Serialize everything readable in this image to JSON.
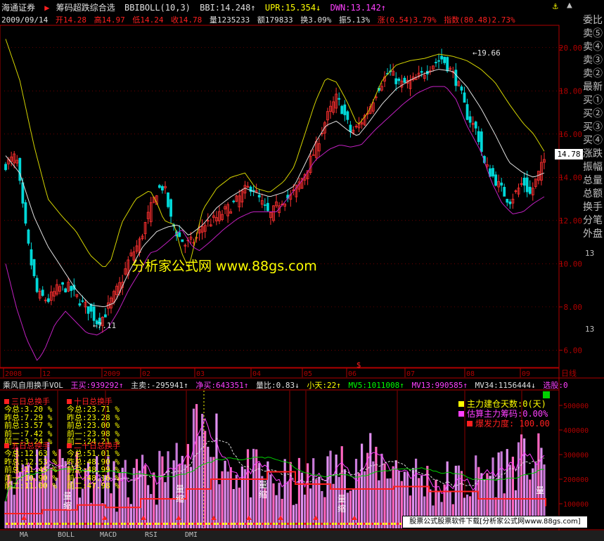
{
  "header": {
    "app_name": "海通证券",
    "indicator_name": "筹码超跌综合选",
    "bbiboll": "BBIBOLL(10,3)",
    "bbi": "BBI:14.248↑",
    "upr": "UPR:15.354↓",
    "dwn": "DWN:13.142↑",
    "date": "2009/09/14",
    "open": "开14.28",
    "high": "高14.97",
    "low": "低14.24",
    "close": "收14.78",
    "volume": "量1235233",
    "amount": "额179833",
    "turnover": "换3.09%",
    "amplitude": "振5.13%",
    "change": "涨(0.54)3.79%",
    "index": "指数(80.48)2.73%"
  },
  "colors": {
    "upper": "#d4d400",
    "mid": "#e0e0e0",
    "lower": "#c020c0",
    "up_candle": "#ff3030",
    "down_candle": "#00d8d8",
    "axis": "#b00000",
    "yellow": "#ffff00",
    "magenta": "#ff40ff",
    "white": "#e0e0e0",
    "green": "#00ff00",
    "red": "#ff2020"
  },
  "price_axis": {
    "ticks": [
      "20.00",
      "18.00",
      "16.00",
      "14.00",
      "12.00",
      "10.00",
      "8.00",
      "6.00"
    ],
    "current": "14.78",
    "high_label": "19.66",
    "low_label": "7.11"
  },
  "time_axis": {
    "labels": [
      "2008",
      "12",
      "2009",
      "02",
      "03",
      "04",
      "05",
      "06",
      "07",
      "08",
      "09"
    ],
    "period": "日线",
    "marker": "$"
  },
  "right_panel": {
    "items": [
      "委比",
      "卖⑤",
      "卖④",
      "卖③",
      "卖②",
      "最新",
      "买①",
      "买②",
      "买③",
      "买④",
      "涨跌",
      "振幅",
      "总量",
      "总额",
      "换手",
      "分笔",
      "外盘"
    ],
    "values": [
      "13",
      "13"
    ]
  },
  "volume_panel": {
    "header": {
      "name": "乘风自用换手VOL",
      "wangmai": "王买:939292↑",
      "zhumai": "主卖:-295941↑",
      "jingmai": "净买:643351↑",
      "liangbi": "量比:0.83↓",
      "xiaotian": "小天:22↑",
      "mv5": "MV5:1011008↑",
      "mv13": "MV13:990585↑",
      "mv34": "MV34:1156444↓",
      "xuangu": "选股:0"
    },
    "ticks": [
      "500000",
      "400000",
      "300000",
      "200000",
      "100000"
    ],
    "turnover": {
      "three": {
        "title": "三日总换手",
        "rows": [
          "今总:3.20 %",
          "昨总:7.29 %",
          "前总:3.57 %",
          "前一:7.42 %",
          "前二:3.24 %"
        ]
      },
      "ten": {
        "title": "十日总换手",
        "rows": [
          "今总:23.71 %",
          "昨总:23.28 %",
          "前总:23.00 %",
          "前一:23.98 %",
          "前二:24.21 %"
        ]
      },
      "five": {
        "title": "五日总换手",
        "rows": [
          "今总:12.63 %",
          "昨总:12.53 %",
          "前总:11.45 %",
          "前一:10.90 %",
          "前二:11.00 %"
        ]
      },
      "twenty": {
        "title": "二十日总换手",
        "rows": [
          "今总:51.01 %",
          "昨总:48.90 %",
          "前总:48.99 %",
          "前一:48.16 %",
          "前二:47.98 %"
        ]
      }
    },
    "legend": [
      {
        "text": "主力建仓天数:0(天)",
        "color": "#ffff00"
      },
      {
        "text": "估算主力筹码:0.00%",
        "color": "#ff40ff"
      },
      {
        "text": "爆发力度: 100.00",
        "color": "#ff2020"
      }
    ],
    "annotations": [
      "量",
      "缩",
      "量",
      "缩",
      "量",
      "缩",
      "量",
      "缩",
      "量"
    ]
  },
  "tabs": [
    "MA",
    "BOLL",
    "MACD",
    "RSI",
    "DMI"
  ],
  "footer_banner": "股票公式股票软件下载[分析家公式网www.88gs.com]",
  "watermark": "分析家公式网 www.88gs.com",
  "chart_data": {
    "type": "line",
    "title": "",
    "ylim": [
      5.2,
      21.0
    ],
    "x_count": 190,
    "upper_anchors": [
      [
        0,
        20.4
      ],
      [
        8,
        18.5
      ],
      [
        16,
        15.5
      ],
      [
        24,
        13.0
      ],
      [
        32,
        12.2
      ],
      [
        40,
        11.5
      ],
      [
        48,
        10.4
      ],
      [
        56,
        9.8
      ],
      [
        60,
        10.2
      ],
      [
        66,
        11.9
      ],
      [
        74,
        13.0
      ],
      [
        82,
        13.4
      ],
      [
        86,
        12.8
      ],
      [
        90,
        12.0
      ],
      [
        96,
        11.8
      ],
      [
        100,
        10.5
      ],
      [
        104,
        9.8
      ],
      [
        112,
        12.5
      ],
      [
        120,
        13.5
      ],
      [
        128,
        14.0
      ],
      [
        136,
        14.2
      ],
      [
        142,
        13.5
      ],
      [
        150,
        13.3
      ],
      [
        158,
        13.8
      ],
      [
        164,
        14.5
      ],
      [
        170,
        16.0
      ],
      [
        176,
        17.5
      ],
      [
        182,
        18.6
      ],
      [
        188,
        18.4
      ],
      [
        194,
        17.5
      ],
      [
        200,
        16.4
      ],
      [
        206,
        17.0
      ],
      [
        214,
        18.5
      ],
      [
        222,
        19.2
      ],
      [
        230,
        19.4
      ],
      [
        238,
        19.5
      ],
      [
        246,
        19.7
      ],
      [
        254,
        19.6
      ],
      [
        262,
        19.4
      ],
      [
        270,
        19.0
      ],
      [
        278,
        18.4
      ],
      [
        286,
        17.4
      ],
      [
        294,
        16.5
      ],
      [
        300,
        16.0
      ],
      [
        306,
        15.2
      ]
    ],
    "mid_anchors": [
      [
        0,
        15.0
      ],
      [
        8,
        14.2
      ],
      [
        16,
        12.2
      ],
      [
        24,
        10.8
      ],
      [
        32,
        9.8
      ],
      [
        40,
        8.8
      ],
      [
        48,
        8.1
      ],
      [
        56,
        8.0
      ],
      [
        62,
        8.2
      ],
      [
        70,
        9.6
      ],
      [
        78,
        10.8
      ],
      [
        86,
        11.5
      ],
      [
        92,
        11.7
      ],
      [
        98,
        11.8
      ],
      [
        104,
        11.3
      ],
      [
        112,
        11.8
      ],
      [
        120,
        12.6
      ],
      [
        128,
        13.1
      ],
      [
        136,
        13.5
      ],
      [
        142,
        13.3
      ],
      [
        150,
        13.1
      ],
      [
        158,
        13.3
      ],
      [
        164,
        13.6
      ],
      [
        170,
        14.6
      ],
      [
        176,
        15.6
      ],
      [
        182,
        16.4
      ],
      [
        188,
        16.6
      ],
      [
        194,
        16.2
      ],
      [
        200,
        15.9
      ],
      [
        206,
        16.5
      ],
      [
        214,
        17.4
      ],
      [
        222,
        18.1
      ],
      [
        230,
        18.5
      ],
      [
        238,
        18.8
      ],
      [
        246,
        19.0
      ],
      [
        254,
        18.9
      ],
      [
        262,
        18.2
      ],
      [
        270,
        17.2
      ],
      [
        278,
        16.0
      ],
      [
        286,
        14.7
      ],
      [
        294,
        14.2
      ],
      [
        300,
        14.0
      ],
      [
        306,
        14.2
      ]
    ],
    "lower_anchors": [
      [
        0,
        10.0
      ],
      [
        6,
        8.0
      ],
      [
        12,
        6.5
      ],
      [
        18,
        5.5
      ],
      [
        22,
        6.0
      ],
      [
        28,
        7.2
      ],
      [
        34,
        7.8
      ],
      [
        40,
        7.3
      ],
      [
        46,
        6.8
      ],
      [
        52,
        6.7
      ],
      [
        58,
        7.0
      ],
      [
        64,
        7.8
      ],
      [
        70,
        8.8
      ],
      [
        76,
        9.6
      ],
      [
        82,
        10.5
      ],
      [
        86,
        10.6
      ],
      [
        92,
        11.0
      ],
      [
        100,
        11.6
      ],
      [
        106,
        10.8
      ],
      [
        110,
        10.6
      ],
      [
        116,
        11.0
      ],
      [
        124,
        11.6
      ],
      [
        132,
        12.1
      ],
      [
        140,
        12.4
      ],
      [
        148,
        12.4
      ],
      [
        154,
        12.4
      ],
      [
        160,
        13.0
      ],
      [
        168,
        13.8
      ],
      [
        176,
        14.8
      ],
      [
        184,
        15.3
      ],
      [
        190,
        15.5
      ],
      [
        196,
        15.4
      ],
      [
        202,
        15.5
      ],
      [
        210,
        16.2
      ],
      [
        218,
        16.8
      ],
      [
        226,
        17.4
      ],
      [
        234,
        17.9
      ],
      [
        242,
        18.2
      ],
      [
        250,
        18.2
      ],
      [
        256,
        17.6
      ],
      [
        262,
        16.4
      ],
      [
        270,
        15.2
      ],
      [
        276,
        13.8
      ],
      [
        282,
        12.8
      ],
      [
        288,
        12.3
      ],
      [
        294,
        12.4
      ],
      [
        300,
        12.8
      ],
      [
        306,
        13.1
      ]
    ],
    "close_anchors": [
      [
        0,
        14.6
      ],
      [
        6,
        15.0
      ],
      [
        10,
        12.4
      ],
      [
        14,
        10.2
      ],
      [
        18,
        8.6
      ],
      [
        24,
        8.3
      ],
      [
        30,
        8.9
      ],
      [
        36,
        8.9
      ],
      [
        42,
        8.3
      ],
      [
        48,
        7.8
      ],
      [
        52,
        7.3
      ],
      [
        56,
        7.6
      ],
      [
        60,
        8.3
      ],
      [
        66,
        9.2
      ],
      [
        70,
        10.2
      ],
      [
        76,
        11.0
      ],
      [
        80,
        12.0
      ],
      [
        86,
        13.4
      ],
      [
        90,
        13.6
      ],
      [
        94,
        12.0
      ],
      [
        98,
        11.3
      ],
      [
        102,
        10.9
      ],
      [
        108,
        11.1
      ],
      [
        112,
        11.8
      ],
      [
        118,
        12.0
      ],
      [
        124,
        12.4
      ],
      [
        130,
        12.8
      ],
      [
        136,
        13.4
      ],
      [
        140,
        13.6
      ],
      [
        144,
        13.0
      ],
      [
        150,
        12.2
      ],
      [
        156,
        12.9
      ],
      [
        162,
        13.1
      ],
      [
        166,
        13.6
      ],
      [
        170,
        14.2
      ],
      [
        176,
        15.3
      ],
      [
        182,
        16.7
      ],
      [
        188,
        17.7
      ],
      [
        192,
        17.0
      ],
      [
        196,
        16.1
      ],
      [
        200,
        16.3
      ],
      [
        206,
        17.1
      ],
      [
        212,
        18.2
      ],
      [
        218,
        18.9
      ],
      [
        224,
        18.3
      ],
      [
        230,
        18.4
      ],
      [
        236,
        18.7
      ],
      [
        242,
        19.2
      ],
      [
        248,
        19.5
      ],
      [
        254,
        18.8
      ],
      [
        258,
        18.1
      ],
      [
        262,
        16.9
      ],
      [
        268,
        16.1
      ],
      [
        272,
        14.6
      ],
      [
        278,
        13.9
      ],
      [
        282,
        13.4
      ],
      [
        286,
        12.9
      ],
      [
        290,
        13.3
      ],
      [
        294,
        13.8
      ],
      [
        298,
        13.2
      ],
      [
        302,
        14.0
      ],
      [
        306,
        14.8
      ]
    ]
  }
}
